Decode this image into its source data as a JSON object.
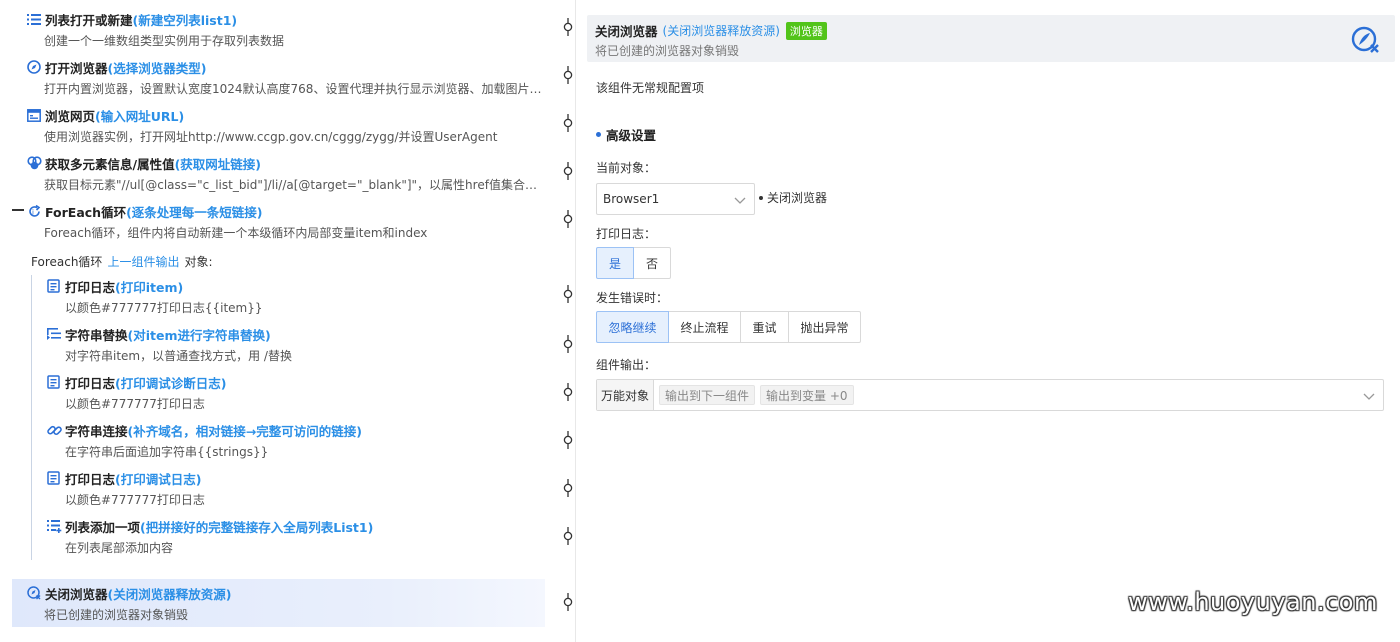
{
  "steps": [
    {
      "name": "列表打开或新建",
      "note": "(新建空列表list1)",
      "desc": "创建一个一维数组类型实例用于存取列表数据",
      "icon": "list-icon"
    },
    {
      "name": "打开浏览器",
      "note": "(选择浏览器类型)",
      "desc": "打开内置浏览器，设置默认宽度1024默认高度768、设置代理并执行显示浏览器、加载图片、…",
      "icon": "compass-icon"
    },
    {
      "name": "浏览网页",
      "note": "(输入网址URL)",
      "desc": "使用浏览器实例，打开网址http://www.ccgp.gov.cn/cggg/zygg/并设置UserAgent",
      "icon": "browser-window-icon"
    },
    {
      "name": "获取多元素信息/属性值",
      "note": "(获取网址链接)",
      "desc": "获取目标元素\"//ul[@class=\"c_list_bid\"]/li//a[@target=\"_blank\"]\"，以属性href值集合返回",
      "icon": "elements-icon"
    },
    {
      "name": "ForEach循环",
      "note": " (逐条处理每一条短链接)",
      "desc": "Foreach循环，组件内将自动新建一个本级循环内局部变量item和index",
      "icon": "loop-icon"
    },
    {
      "name": "打印日志",
      "note": "(打印item)",
      "desc": "以颜色#777777打印日志{{item}}",
      "icon": "log-icon"
    },
    {
      "name": "字符串替换",
      "note": "(对item进行字符串替换)",
      "desc": "对字符串item，以普通查找方式，用 /替换",
      "icon": "replace-icon"
    },
    {
      "name": "打印日志",
      "note": "(打印调试诊断日志)",
      "desc": "以颜色#777777打印日志",
      "icon": "log-icon"
    },
    {
      "name": "字符串连接",
      "note": "(补齐域名，相对链接→完整可访问的链接)",
      "desc": "在字符串后面追加字符串{{strings}}",
      "icon": "link-icon"
    },
    {
      "name": "打印日志",
      "note": "(打印调试日志)",
      "desc": "以颜色#777777打印日志",
      "icon": "log-icon"
    },
    {
      "name": "列表添加一项",
      "note": "(把拼接好的完整链接存入全局列表List1)",
      "desc": "在列表尾部添加内容",
      "icon": "list-add-icon"
    },
    {
      "name": "关闭浏览器",
      "note": "(关闭浏览器释放资源)",
      "desc": "将已创建的浏览器对象销毁",
      "icon": "close-browser-icon"
    }
  ],
  "loop_label": {
    "prefix": "Foreach循环",
    "link": "上一组件输出",
    "suffix": "对象:"
  },
  "config": {
    "title": "关闭浏览器",
    "note": "(关闭浏览器释放资源)",
    "tag": "浏览器",
    "desc": "将已创建的浏览器对象销毁",
    "no_config": "该组件无常规配置项",
    "advanced": "高级设置",
    "current_object_label": "当前对象：",
    "current_object_value": "Browser1",
    "current_object_hint": "关闭浏览器",
    "print_log_label": "打印日志：",
    "print_log_options": [
      "是",
      "否"
    ],
    "on_error_label": "发生错误时：",
    "on_error_options": [
      "忽略继续",
      "终止流程",
      "重试",
      "抛出异常"
    ],
    "output_label": "组件输出：",
    "output_type": "万能对象",
    "output_chip1": "输出到下一组件",
    "output_chip2": "输出到变量 +0"
  },
  "colors": {
    "accent": "#2b8fe6",
    "tag": "#52c41a",
    "active_bg": "#e4ecfb"
  },
  "watermark": "www.huoyuyan.com"
}
